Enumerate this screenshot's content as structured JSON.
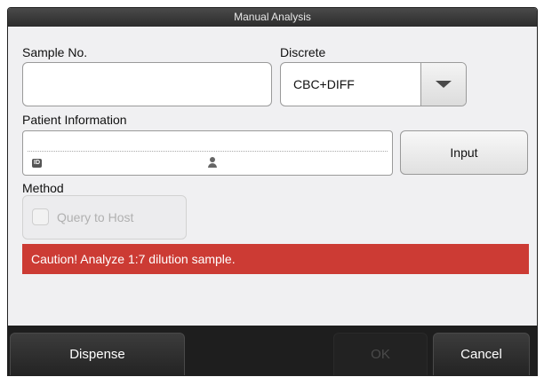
{
  "dialog": {
    "title": "Manual Analysis"
  },
  "sample": {
    "label": "Sample No.",
    "value": ""
  },
  "discrete": {
    "label": "Discrete",
    "selected": "CBC+DIFF"
  },
  "patient": {
    "label": "Patient Information",
    "id_icon_text": "ID",
    "input_button": "Input"
  },
  "method": {
    "label": "Method",
    "query_to_host": "Query to Host",
    "query_checked": false
  },
  "caution": {
    "message": "Caution! Analyze 1:7 dilution sample.",
    "color": "#cc3b34"
  },
  "footer": {
    "dispense": "Dispense",
    "ok": "OK",
    "cancel": "Cancel"
  },
  "icons": {
    "select_arrow": "chevron-down-icon",
    "patient_id": "id-card-icon",
    "patient_name": "person-icon",
    "query_checkbox": "checkbox-icon"
  }
}
